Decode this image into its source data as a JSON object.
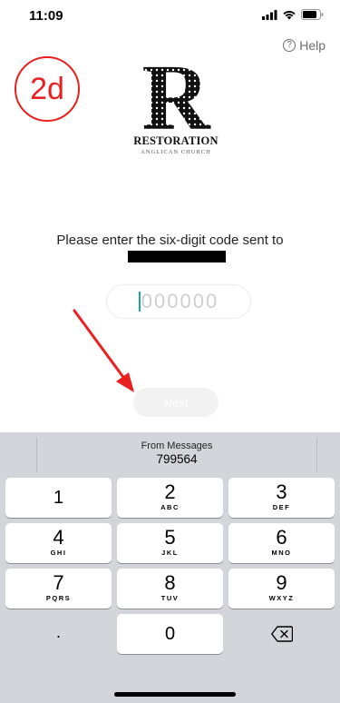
{
  "status_bar": {
    "time": "11:09"
  },
  "header": {
    "help_label": "Help",
    "help_icon": "?"
  },
  "annotation": {
    "label": "2d",
    "color": "#e82020"
  },
  "logo": {
    "letter": "R",
    "name": "RESTORATION",
    "subtitle": "ANGLICAN CHURCH"
  },
  "verification": {
    "prompt": "Please enter the six-digit code sent to",
    "code_placeholder": "000000"
  },
  "actions": {
    "next_label": "Next"
  },
  "keyboard": {
    "suggestion_label": "From Messages",
    "suggestion_code": "799564",
    "keys": [
      {
        "digit": "1",
        "letters": ""
      },
      {
        "digit": "2",
        "letters": "ABC"
      },
      {
        "digit": "3",
        "letters": "DEF"
      },
      {
        "digit": "4",
        "letters": "GHI"
      },
      {
        "digit": "5",
        "letters": "JKL"
      },
      {
        "digit": "6",
        "letters": "MNO"
      },
      {
        "digit": "7",
        "letters": "PQRS"
      },
      {
        "digit": "8",
        "letters": "TUV"
      },
      {
        "digit": "9",
        "letters": "WXYZ"
      },
      {
        "digit": "0",
        "letters": ""
      }
    ],
    "decimal_key": ".",
    "delete_icon": "backspace-icon"
  },
  "colors": {
    "accent_caret": "#1aa6a6",
    "keyboard_bg": "#d3d5da",
    "annotation": "#e82020"
  }
}
